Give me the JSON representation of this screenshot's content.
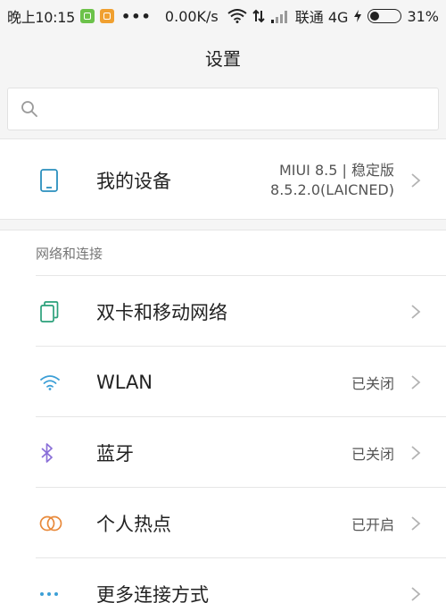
{
  "status_bar": {
    "time": "晚上10:15",
    "dots": "•••",
    "speed": "0.00K/s",
    "carrier": "联通 4G",
    "battery_percent": "31%",
    "battery_level": 0.31
  },
  "title": "设置",
  "search": {
    "placeholder": ""
  },
  "device": {
    "label": "我的设备",
    "value_line1": "MIUI 8.5 | 稳定版",
    "value_line2": "8.5.2.0(LAICNED)"
  },
  "network_section": {
    "header": "网络和连接",
    "items": [
      {
        "icon": "dual-sim-icon",
        "label": "双卡和移动网络",
        "value": ""
      },
      {
        "icon": "wifi-icon",
        "label": "WLAN",
        "value": "已关闭"
      },
      {
        "icon": "bluetooth-icon",
        "label": "蓝牙",
        "value": "已关闭"
      },
      {
        "icon": "hotspot-icon",
        "label": "个人热点",
        "value": "已开启"
      },
      {
        "icon": "more-dots-icon",
        "label": "更多连接方式",
        "value": ""
      }
    ]
  },
  "colors": {
    "device_icon": "#2a8fbd",
    "sim_icon": "#2aa07a",
    "wifi_icon": "#3c9fd6",
    "bluetooth_icon": "#8a6fd8",
    "hotspot_icon": "#e8893a",
    "more_icon": "#3c9fd6"
  }
}
